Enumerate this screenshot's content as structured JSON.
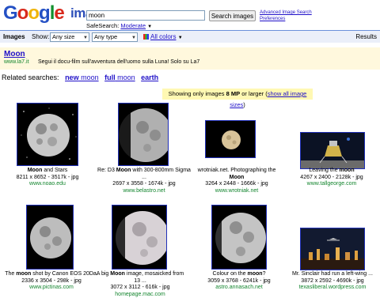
{
  "header": {
    "logo_text": "Google",
    "logo_sub": "images",
    "search_value": "moon",
    "search_button": "Search images",
    "advanced_link": "Advanced Image Search",
    "preferences_link": "Preferences",
    "safesearch_label": "SafeSearch:",
    "safesearch_value": "Moderate"
  },
  "toolbar": {
    "title": "Images",
    "show_label": "Show:",
    "size_select": "Any size",
    "type_select": "Any type",
    "colors_link": "All colors",
    "results_label": "Results"
  },
  "ad": {
    "title": "Moon",
    "url": "www.la7.it",
    "text": "Segui il docu-film sull'avventura dell'uomo sulla Luna! Solo su La7"
  },
  "related": {
    "label": "Related searches:",
    "items": [
      {
        "bold": "new",
        "rest": " moon"
      },
      {
        "bold": "full",
        "rest": " moon"
      },
      {
        "bold": "earth",
        "rest": ""
      }
    ]
  },
  "notice": {
    "prefix": "Showing only images ",
    "bold": "8 MP",
    "suffix": " or larger (",
    "link": "show all image sizes",
    "end": ")"
  },
  "results": [
    {
      "line1": "Moon and Stars",
      "line1_bold": "Moon",
      "line1_rest": " and Stars",
      "line2": "8211 x 8652 - 3517k - jpg",
      "site": "www.noao.edu"
    },
    {
      "line1_pre": "Re: D3 ",
      "line1_bold": "Moon",
      "line1_rest": " with 300-800mm Sigma",
      "line1b": "...",
      "line2": "2697 x 3558 - 1674k - jpg",
      "site": "www.belastro.net"
    },
    {
      "line1_pre": "wrotniak.net. Photographing the",
      "line1_bold": "Moon",
      "line2": "3264 x 2448 - 1666k - jpg",
      "site": "www.wrotniak.net"
    },
    {
      "line1_pre": "Leaving the ",
      "line1_bold": "moon",
      "line2": "4267 x 2400 - 2128k - jpg",
      "site": "www.tallgeorge.com"
    },
    {
      "line1_pre": "The ",
      "line1_bold": "moon",
      "line1_rest": " shot by Canon EOS 20Da.",
      "line2": "2336 x 3504 - 298k - jpg",
      "site": "www.pictinas.com"
    },
    {
      "line1_pre": "A big ",
      "line1_bold": "Moon",
      "line1_rest": " image, mosaicked from",
      "line1b": "13 ...",
      "line2": "3072 x 3112 - 616k - jpg",
      "site": "homepage.mac.com"
    },
    {
      "line1_pre": "Colour on the ",
      "line1_bold": "moon",
      "line1_rest": "?",
      "line2": "3059 x 3768 - 6241k - jpg",
      "site": "astro.annasach.net"
    },
    {
      "line1_pre": "Mr. Sinclair had run a left-wing ...",
      "line2": "3872 x 2592 - 4690k - jpg",
      "site": "texasliberal.wordpress.com"
    }
  ]
}
